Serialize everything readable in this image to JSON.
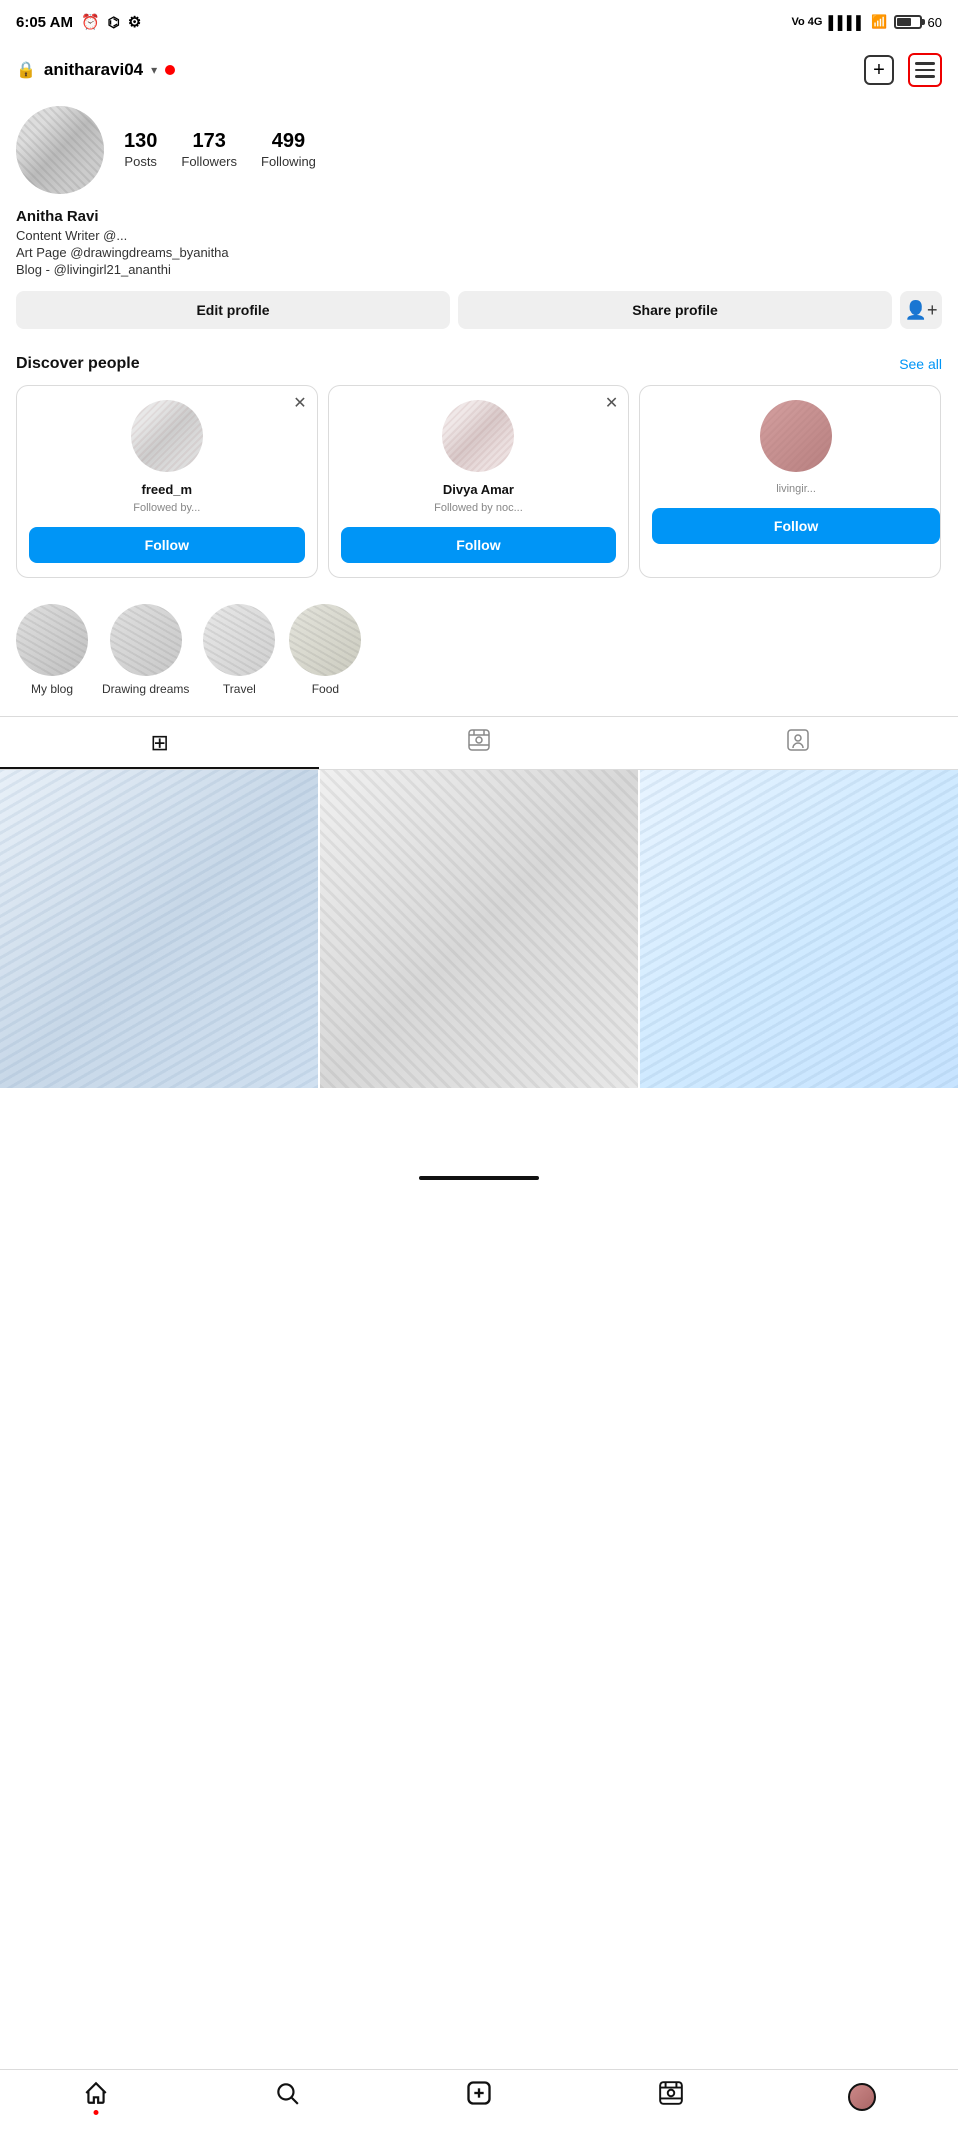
{
  "status_bar": {
    "time": "6:05 AM",
    "battery": "60"
  },
  "top_nav": {
    "username": "anitharavi04",
    "add_icon": "+",
    "menu_icon": "≡"
  },
  "profile": {
    "name": "Anitha Ravi",
    "bio_lines": [
      "Content Writer @...",
      "Art Page @drawingdreams_byanitha",
      "Blog - @livingirl21_ananthi"
    ],
    "stats": {
      "posts_count": "130",
      "posts_label": "Posts",
      "followers_count": "173",
      "followers_label": "Followers",
      "following_count": "499",
      "following_label": "Following"
    }
  },
  "buttons": {
    "edit_profile": "Edit profile",
    "share_profile": "Share profile"
  },
  "discover": {
    "title": "Discover people",
    "see_all": "See all",
    "cards": [
      {
        "name": "freed_m",
        "meta": "Followed by...",
        "follow_label": "Follow"
      },
      {
        "name": "Divya Amar",
        "meta": "Followed by noc...",
        "follow_label": "Follow"
      },
      {
        "name": "...",
        "meta": "livingir...",
        "follow_label": "Follow"
      }
    ]
  },
  "highlights": [
    {
      "label": "My blog"
    },
    {
      "label": "Drawing dreams"
    },
    {
      "label": "Travel"
    },
    {
      "label": "Food"
    }
  ],
  "tabs": {
    "grid_label": "Grid",
    "reels_label": "Reels",
    "tagged_label": "Tagged"
  },
  "bottom_nav": {
    "home": "⌂",
    "search": "⌕",
    "add": "+",
    "reels": "▶"
  }
}
